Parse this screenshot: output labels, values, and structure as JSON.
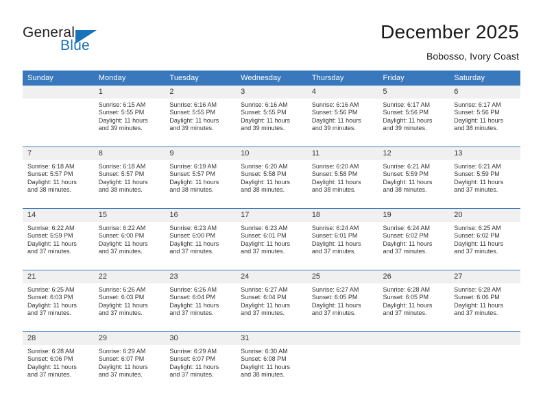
{
  "logo": {
    "word1": "General",
    "word2": "Blue",
    "triangle_icon": "triangle-icon",
    "accent_color": "#1a72b8"
  },
  "header": {
    "title": "December 2025",
    "subtitle": "Bobosso, Ivory Coast"
  },
  "calendar": {
    "header_color": "#3a78bd",
    "daynum_bg": "#f0f0f0",
    "weekday_headers": [
      "Sunday",
      "Monday",
      "Tuesday",
      "Wednesday",
      "Thursday",
      "Friday",
      "Saturday"
    ],
    "weeks": [
      [
        {
          "day": "",
          "lines": []
        },
        {
          "day": "1",
          "lines": [
            "Sunrise: 6:15 AM",
            "Sunset: 5:55 PM",
            "Daylight: 11 hours",
            "and 39 minutes."
          ]
        },
        {
          "day": "2",
          "lines": [
            "Sunrise: 6:16 AM",
            "Sunset: 5:55 PM",
            "Daylight: 11 hours",
            "and 39 minutes."
          ]
        },
        {
          "day": "3",
          "lines": [
            "Sunrise: 6:16 AM",
            "Sunset: 5:55 PM",
            "Daylight: 11 hours",
            "and 39 minutes."
          ]
        },
        {
          "day": "4",
          "lines": [
            "Sunrise: 6:16 AM",
            "Sunset: 5:56 PM",
            "Daylight: 11 hours",
            "and 39 minutes."
          ]
        },
        {
          "day": "5",
          "lines": [
            "Sunrise: 6:17 AM",
            "Sunset: 5:56 PM",
            "Daylight: 11 hours",
            "and 39 minutes."
          ]
        },
        {
          "day": "6",
          "lines": [
            "Sunrise: 6:17 AM",
            "Sunset: 5:56 PM",
            "Daylight: 11 hours",
            "and 38 minutes."
          ]
        }
      ],
      [
        {
          "day": "7",
          "lines": [
            "Sunrise: 6:18 AM",
            "Sunset: 5:57 PM",
            "Daylight: 11 hours",
            "and 38 minutes."
          ]
        },
        {
          "day": "8",
          "lines": [
            "Sunrise: 6:18 AM",
            "Sunset: 5:57 PM",
            "Daylight: 11 hours",
            "and 38 minutes."
          ]
        },
        {
          "day": "9",
          "lines": [
            "Sunrise: 6:19 AM",
            "Sunset: 5:57 PM",
            "Daylight: 11 hours",
            "and 38 minutes."
          ]
        },
        {
          "day": "10",
          "lines": [
            "Sunrise: 6:20 AM",
            "Sunset: 5:58 PM",
            "Daylight: 11 hours",
            "and 38 minutes."
          ]
        },
        {
          "day": "11",
          "lines": [
            "Sunrise: 6:20 AM",
            "Sunset: 5:58 PM",
            "Daylight: 11 hours",
            "and 38 minutes."
          ]
        },
        {
          "day": "12",
          "lines": [
            "Sunrise: 6:21 AM",
            "Sunset: 5:59 PM",
            "Daylight: 11 hours",
            "and 38 minutes."
          ]
        },
        {
          "day": "13",
          "lines": [
            "Sunrise: 6:21 AM",
            "Sunset: 5:59 PM",
            "Daylight: 11 hours",
            "and 37 minutes."
          ]
        }
      ],
      [
        {
          "day": "14",
          "lines": [
            "Sunrise: 6:22 AM",
            "Sunset: 5:59 PM",
            "Daylight: 11 hours",
            "and 37 minutes."
          ]
        },
        {
          "day": "15",
          "lines": [
            "Sunrise: 6:22 AM",
            "Sunset: 6:00 PM",
            "Daylight: 11 hours",
            "and 37 minutes."
          ]
        },
        {
          "day": "16",
          "lines": [
            "Sunrise: 6:23 AM",
            "Sunset: 6:00 PM",
            "Daylight: 11 hours",
            "and 37 minutes."
          ]
        },
        {
          "day": "17",
          "lines": [
            "Sunrise: 6:23 AM",
            "Sunset: 6:01 PM",
            "Daylight: 11 hours",
            "and 37 minutes."
          ]
        },
        {
          "day": "18",
          "lines": [
            "Sunrise: 6:24 AM",
            "Sunset: 6:01 PM",
            "Daylight: 11 hours",
            "and 37 minutes."
          ]
        },
        {
          "day": "19",
          "lines": [
            "Sunrise: 6:24 AM",
            "Sunset: 6:02 PM",
            "Daylight: 11 hours",
            "and 37 minutes."
          ]
        },
        {
          "day": "20",
          "lines": [
            "Sunrise: 6:25 AM",
            "Sunset: 6:02 PM",
            "Daylight: 11 hours",
            "and 37 minutes."
          ]
        }
      ],
      [
        {
          "day": "21",
          "lines": [
            "Sunrise: 6:25 AM",
            "Sunset: 6:03 PM",
            "Daylight: 11 hours",
            "and 37 minutes."
          ]
        },
        {
          "day": "22",
          "lines": [
            "Sunrise: 6:26 AM",
            "Sunset: 6:03 PM",
            "Daylight: 11 hours",
            "and 37 minutes."
          ]
        },
        {
          "day": "23",
          "lines": [
            "Sunrise: 6:26 AM",
            "Sunset: 6:04 PM",
            "Daylight: 11 hours",
            "and 37 minutes."
          ]
        },
        {
          "day": "24",
          "lines": [
            "Sunrise: 6:27 AM",
            "Sunset: 6:04 PM",
            "Daylight: 11 hours",
            "and 37 minutes."
          ]
        },
        {
          "day": "25",
          "lines": [
            "Sunrise: 6:27 AM",
            "Sunset: 6:05 PM",
            "Daylight: 11 hours",
            "and 37 minutes."
          ]
        },
        {
          "day": "26",
          "lines": [
            "Sunrise: 6:28 AM",
            "Sunset: 6:05 PM",
            "Daylight: 11 hours",
            "and 37 minutes."
          ]
        },
        {
          "day": "27",
          "lines": [
            "Sunrise: 6:28 AM",
            "Sunset: 6:06 PM",
            "Daylight: 11 hours",
            "and 37 minutes."
          ]
        }
      ],
      [
        {
          "day": "28",
          "lines": [
            "Sunrise: 6:28 AM",
            "Sunset: 6:06 PM",
            "Daylight: 11 hours",
            "and 37 minutes."
          ]
        },
        {
          "day": "29",
          "lines": [
            "Sunrise: 6:29 AM",
            "Sunset: 6:07 PM",
            "Daylight: 11 hours",
            "and 37 minutes."
          ]
        },
        {
          "day": "30",
          "lines": [
            "Sunrise: 6:29 AM",
            "Sunset: 6:07 PM",
            "Daylight: 11 hours",
            "and 37 minutes."
          ]
        },
        {
          "day": "31",
          "lines": [
            "Sunrise: 6:30 AM",
            "Sunset: 6:08 PM",
            "Daylight: 11 hours",
            "and 38 minutes."
          ]
        },
        {
          "day": "",
          "lines": []
        },
        {
          "day": "",
          "lines": []
        },
        {
          "day": "",
          "lines": []
        }
      ]
    ]
  }
}
